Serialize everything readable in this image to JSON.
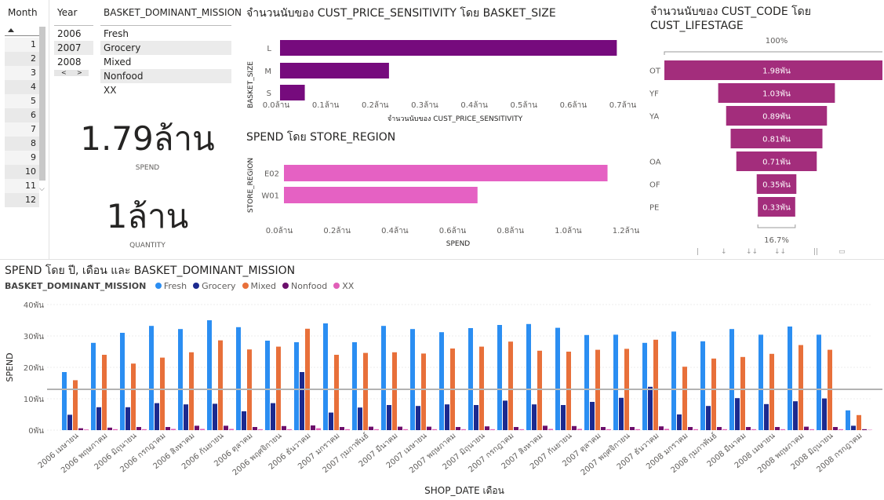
{
  "slicers": {
    "month": {
      "title": "Month",
      "items": [
        "1",
        "2",
        "3",
        "4",
        "5",
        "6",
        "7",
        "8",
        "9",
        "10",
        "11",
        "12"
      ],
      "sort_icon": "triangle-up-icon"
    },
    "year": {
      "title": "Year",
      "items": [
        "2006",
        "2007",
        "2008"
      ],
      "scroll_left": "<",
      "scroll_right": ">"
    },
    "mission": {
      "title": "BASKET_DOMINANT_MISSION",
      "items": [
        "Fresh",
        "Grocery",
        "Mixed",
        "Nonfood",
        "XX"
      ]
    }
  },
  "kpis": {
    "spend": {
      "value": "1.79ล้าน",
      "label": "SPEND"
    },
    "quantity": {
      "value": "1ล้าน",
      "label": "QUANTITY"
    }
  },
  "colors": {
    "fresh": "#2b8ef2",
    "grocery": "#1c2a8f",
    "mixed": "#e8703a",
    "nonfood": "#6b0f6b",
    "xx": "#e15fb8",
    "purple_bar": "#760b7d",
    "pink_bar": "#e561c3",
    "funnel": "#a32d7c"
  },
  "basket_chart": {
    "title": "จำนวนนับของ CUST_PRICE_SENSITIVITY โดย BASKET_SIZE",
    "ylabel": "BASKET_SIZE",
    "xlabel": "จำนวนนับของ CUST_PRICE_SENSITIVITY",
    "ticks": [
      "0.0ล้าน",
      "0.1ล้าน",
      "0.2ล้าน",
      "0.3ล้าน",
      "0.4ล้าน",
      "0.5ล้าน",
      "0.6ล้าน",
      "0.7ล้าน"
    ]
  },
  "region_chart": {
    "title": "SPEND โดย STORE_REGION",
    "ylabel": "STORE_REGION",
    "xlabel": "SPEND",
    "ticks": [
      "0.0ล้าน",
      "0.2ล้าน",
      "0.4ล้าน",
      "0.6ล้าน",
      "0.8ล้าน",
      "1.0ล้าน",
      "1.2ล้าน"
    ]
  },
  "funnel_chart": {
    "title_line1": "จำนวนนับของ CUST_CODE โดย",
    "title_line2": "CUST_LIFESTAGE",
    "top_pct": "100%",
    "bottom_pct": "16.7%"
  },
  "column_chart": {
    "title": "SPEND โดย ปี, เดือน และ BASKET_DOMINANT_MISSION",
    "legend_title": "BASKET_DOMINANT_MISSION",
    "ylabel": "SPEND",
    "xlabel": "SHOP_DATE เดือน",
    "yticks": [
      "40พัน",
      "30พัน",
      "20พัน",
      "10พัน",
      "0พัน"
    ]
  },
  "chart_data": [
    {
      "type": "bar",
      "title": "จำนวนนับของ CUST_PRICE_SENSITIVITY โดย BASKET_SIZE",
      "categories": [
        "L",
        "M",
        "S"
      ],
      "values": [
        0.68,
        0.22,
        0.05
      ],
      "unit": "ล้าน",
      "xlim": [
        0,
        0.7
      ]
    },
    {
      "type": "bar",
      "title": "SPEND โดย STORE_REGION",
      "categories": [
        "E02",
        "W01"
      ],
      "values": [
        1.12,
        0.67
      ],
      "unit": "ล้าน",
      "xlim": [
        0,
        1.2
      ]
    },
    {
      "type": "bar",
      "subtype": "funnel",
      "title": "จำนวนนับของ CUST_CODE โดย CUST_LIFESTAGE",
      "categories": [
        "OT",
        "YF",
        "YA",
        "OA",
        "OF",
        "PE"
      ],
      "values": [
        1.98,
        1.03,
        0.89,
        0.81,
        0.71,
        0.35,
        0.33
      ],
      "labels": [
        "1.98พัน",
        "1.03พัน",
        "0.89พัน",
        "0.81พัน",
        "0.71พัน",
        "0.35พัน",
        "0.33พัน"
      ],
      "row_labels": [
        "OT",
        "YF",
        "YA",
        "",
        "OA",
        "OF",
        "PE"
      ]
    },
    {
      "type": "bar",
      "title": "SPEND โดย ปี, เดือน และ BASKET_DOMINANT_MISSION",
      "ylim": [
        0,
        40
      ],
      "unit": "พัน",
      "reference_line": 13,
      "categories": [
        "2006 เมษายน",
        "2006 พฤษภาคม",
        "2006 มิถุนายน",
        "2006 กรกฎาคม",
        "2006 สิงหาคม",
        "2006 กันยายน",
        "2006 ตุลาคม",
        "2006 พฤศจิกายน",
        "2006 ธันวาคม",
        "2007 มกราคม",
        "2007 กุมภาพันธ์",
        "2007 มีนาคม",
        "2007 เมษายน",
        "2007 พฤษภาคม",
        "2007 มิถุนายน",
        "2007 กรกฎาคม",
        "2007 สิงหาคม",
        "2007 กันยายน",
        "2007 ตุลาคม",
        "2007 พฤศจิกายน",
        "2007 ธันวาคม",
        "2008 มกราคม",
        "2008 กุมภาพันธ์",
        "2008 มีนาคม",
        "2008 เมษายน",
        "2008 พฤษภาคม",
        "2008 มิถุนายน",
        "2008 กรกฎาคม"
      ],
      "series": [
        {
          "name": "Fresh",
          "values": [
            18.5,
            27.8,
            31,
            33.2,
            32.2,
            35,
            32.8,
            28.5,
            28,
            34,
            28,
            33.2,
            32.2,
            31.2,
            32.5,
            33.5,
            33.8,
            32.6,
            30.3,
            30.4,
            27.8,
            31.4,
            28.3,
            32.2,
            30.4,
            33,
            30.4,
            6.3
          ]
        },
        {
          "name": "Grocery",
          "values": [
            4.9,
            7.3,
            7.3,
            8.6,
            8.2,
            8.4,
            6,
            8.6,
            18.5,
            5.6,
            7.2,
            8,
            7.7,
            8.2,
            8,
            9.4,
            8.2,
            8,
            9,
            10.3,
            13.8,
            5,
            7.7,
            10.2,
            8.3,
            9.2,
            10.1,
            1.4
          ]
        },
        {
          "name": "Mixed",
          "values": [
            15.9,
            24,
            21.2,
            23.1,
            24.8,
            28.6,
            25.7,
            26.6,
            32.3,
            24,
            24.6,
            24.8,
            24.4,
            26,
            26.6,
            28.2,
            25.3,
            25,
            25.6,
            25.9,
            28.8,
            20.2,
            22.8,
            23.3,
            24.3,
            27.1,
            25.6,
            4.8
          ]
        },
        {
          "name": "Nonfood",
          "values": [
            0.6,
            0.8,
            1,
            1,
            1.4,
            1.4,
            1,
            1.3,
            1.5,
            1,
            1.1,
            1.1,
            1.1,
            1,
            1.2,
            1,
            1.4,
            1.3,
            1,
            1,
            1.2,
            1,
            1,
            1,
            1,
            1.1,
            1,
            0.3
          ]
        },
        {
          "name": "XX",
          "values": [
            0.2,
            0.3,
            0.3,
            0.4,
            0.4,
            0.4,
            0.3,
            0.3,
            0.6,
            0.3,
            0.3,
            0.3,
            0.3,
            0.3,
            0.3,
            0.3,
            0.4,
            0.4,
            0.3,
            0.3,
            0.4,
            0.3,
            0.3,
            0.3,
            0.3,
            0.3,
            0.3,
            0.1
          ]
        }
      ]
    }
  ]
}
